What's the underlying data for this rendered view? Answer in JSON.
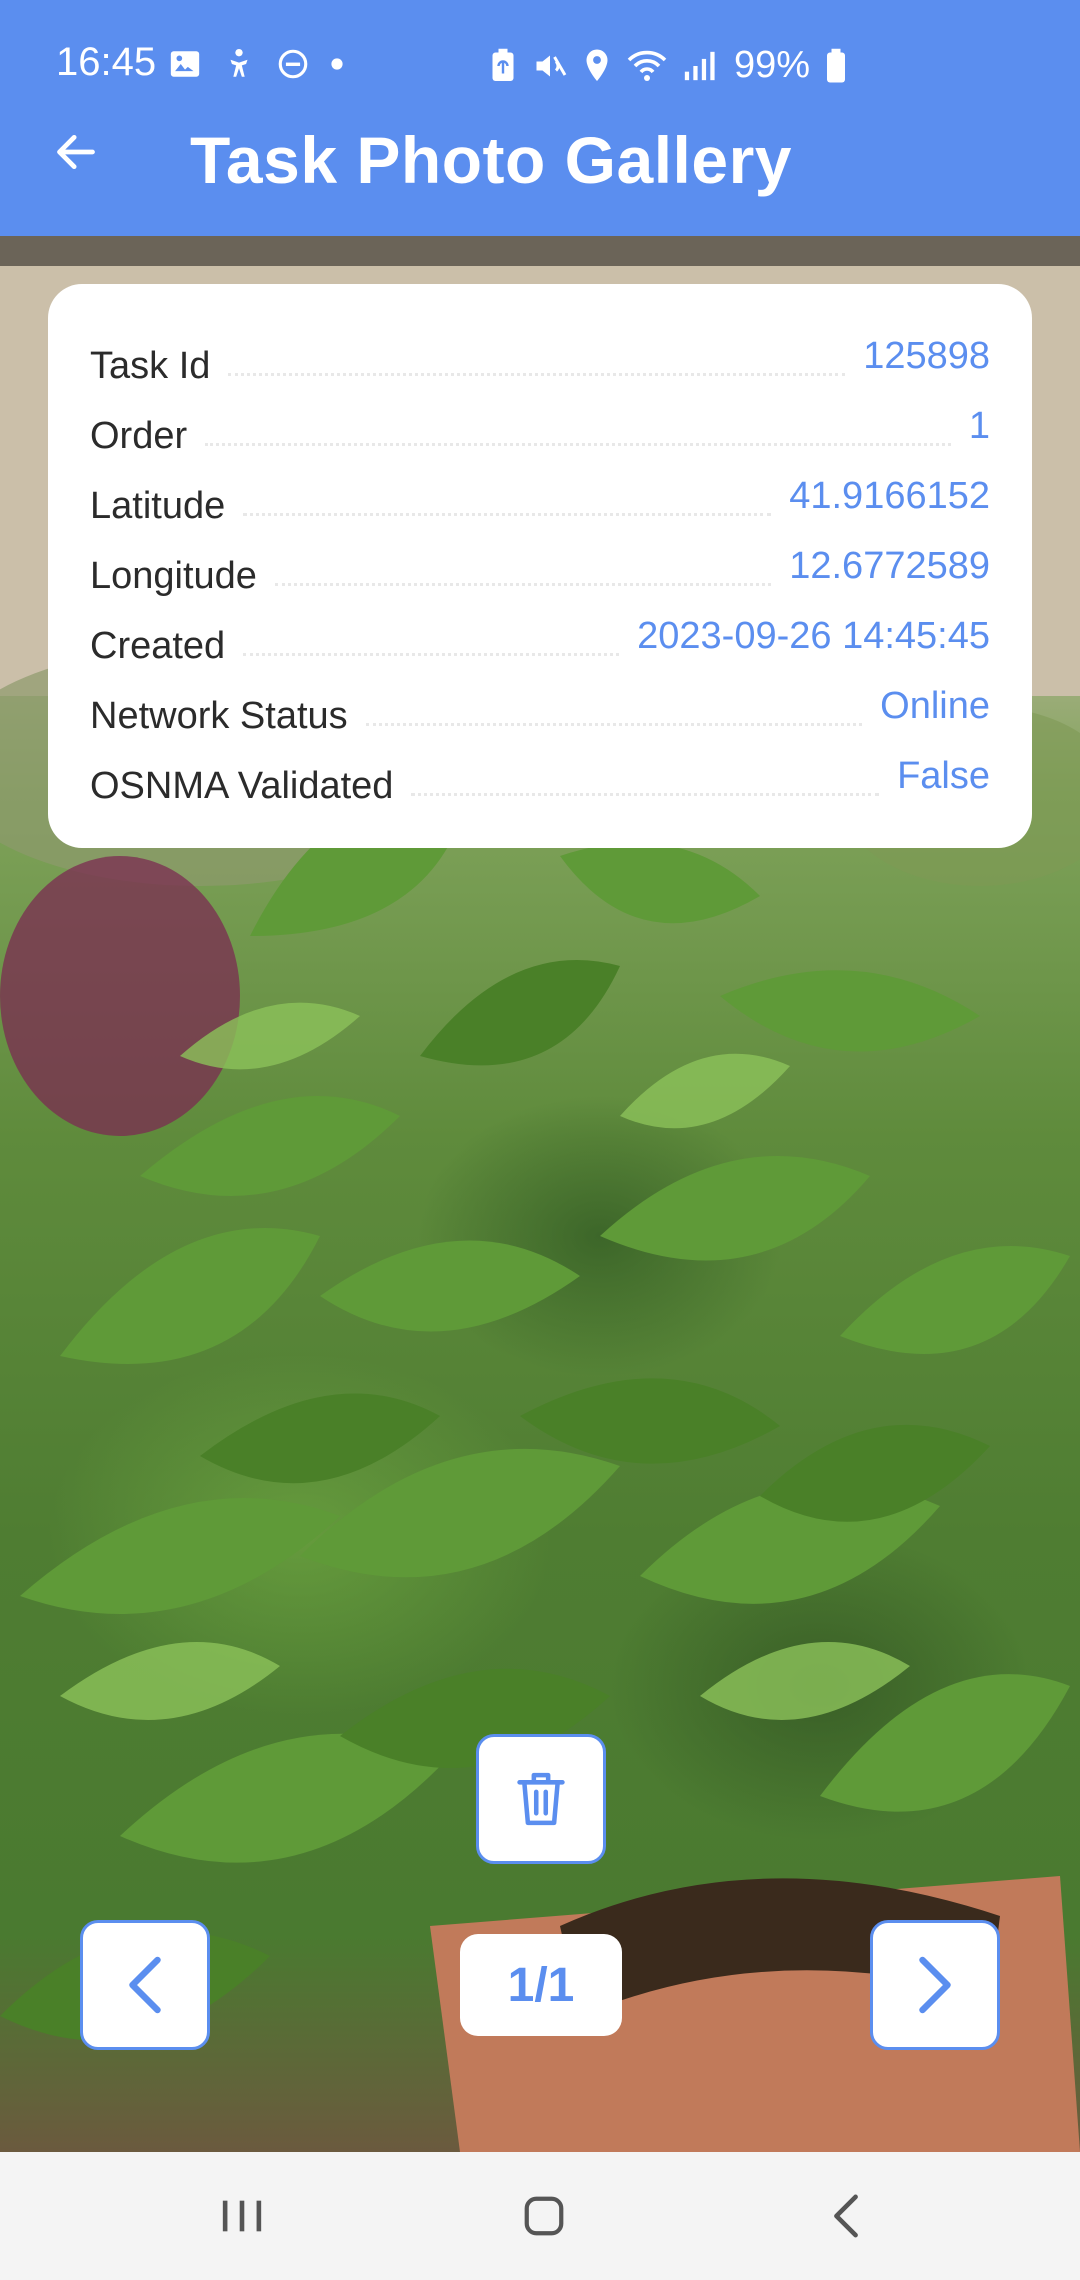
{
  "status_bar": {
    "time": "16:45",
    "battery": "99%",
    "left_icons": [
      "image-icon",
      "accessibility-icon",
      "do-not-disturb-icon",
      "dot-icon"
    ],
    "right_icons": [
      "battery-saver-icon",
      "mute-icon",
      "location-icon",
      "wifi-icon",
      "signal-icon",
      "battery-icon"
    ]
  },
  "app_bar": {
    "title": "Task Photo Gallery",
    "back_icon": "arrow-left-icon"
  },
  "info": {
    "rows": [
      {
        "label": "Task Id",
        "value": "125898"
      },
      {
        "label": "Order",
        "value": "1"
      },
      {
        "label": "Latitude",
        "value": "41.9166152"
      },
      {
        "label": "Longitude",
        "value": "12.6772589"
      },
      {
        "label": "Created",
        "value": "2023-09-26 14:45:45"
      },
      {
        "label": "Network Status",
        "value": "Online"
      },
      {
        "label": "OSNMA Validated",
        "value": "False"
      }
    ]
  },
  "controls": {
    "delete_icon": "trash-icon",
    "prev_icon": "chevron-left-icon",
    "next_icon": "chevron-right-icon",
    "page_indicator": "1/1"
  },
  "colors": {
    "accent": "#5b8eef",
    "card_background": "#ffffff",
    "label_text": "#2b2b2b"
  },
  "nav_bar": {
    "items": [
      "recents-icon",
      "home-icon",
      "back-icon"
    ]
  }
}
